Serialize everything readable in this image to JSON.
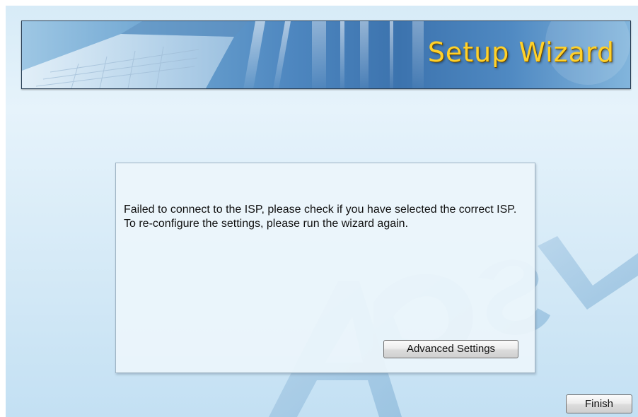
{
  "header": {
    "title": "Setup Wizard"
  },
  "panel": {
    "message": "Failed to connect to the ISP, please check if you have selected the correct ISP. To re-configure the settings, please run the wizard again.",
    "advanced_button": "Advanced Settings"
  },
  "footer": {
    "finish_button": "Finish"
  },
  "icons": {
    "banner_art": "laptop-keyboard-illustration",
    "watermark": "adsl-watermark"
  },
  "colors": {
    "title": "#ffd12a",
    "background": "#d7ebf7",
    "banner": "#4d86bf"
  }
}
